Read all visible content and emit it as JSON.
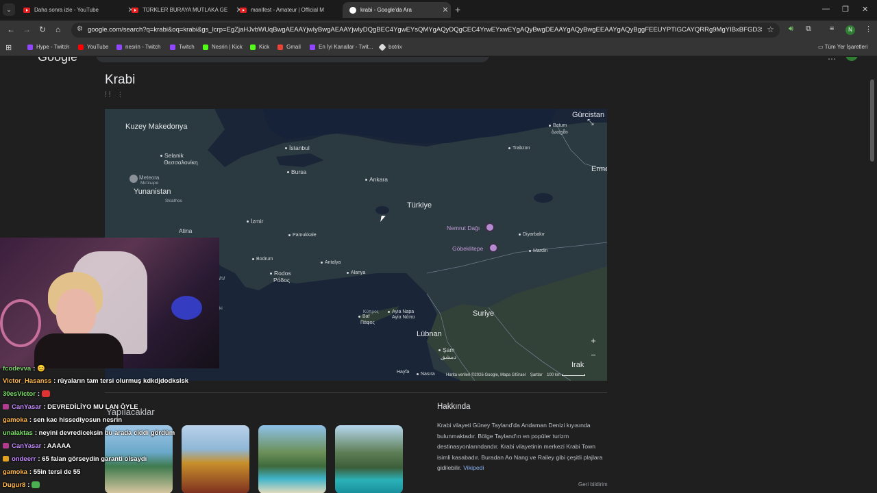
{
  "tabs": [
    {
      "label": "Daha sonra izle - YouTube",
      "icon": "youtube-icon"
    },
    {
      "label": "TÜRKLER BURAYA MUTLAKA GE",
      "icon": "youtube-icon"
    },
    {
      "label": "manifest - Amateur | Official M",
      "icon": "youtube-icon"
    },
    {
      "label": "krabi - Google'da Ara",
      "icon": "google-icon",
      "active": true
    }
  ],
  "address_bar": {
    "url": "google.com/search?q=krabi&oq=krabi&gs_lcrp=EgZjaHJvbWUqBwgAEAAYjwIyBwgAEAAYjwIyDQgBEC4YgwEYsQMYgAQyDQgCEC4YrwEYxwEYgAQyBwgDEAAYgAQyBwgEEAAYgAQyBggFEEUYPTIGCAYQRRg9MgYIBxBFGD3SAQc5NDZqMG..."
  },
  "bookmarks": [
    {
      "label": "Hype - Twitch",
      "color": "#9146ff"
    },
    {
      "label": "YouTube",
      "color": "#ff0000"
    },
    {
      "label": "nesrin - Twitch",
      "color": "#9146ff"
    },
    {
      "label": "Twitch",
      "color": "#9146ff"
    },
    {
      "label": "Nesrin | Kick",
      "color": "#53fc18"
    },
    {
      "label": "Kick",
      "color": "#53fc18"
    },
    {
      "label": "Gmail",
      "color": "#ea4335"
    },
    {
      "label": "En İyi Kanallar - Twit...",
      "color": "#9146ff"
    },
    {
      "label": "botrix",
      "color": "#dddddd"
    }
  ],
  "bookmarks_folder": "Tüm Yer İşaretleri",
  "profile_initial": "N",
  "header": {
    "logo": "Google"
  },
  "entity": {
    "title": "Krabi",
    "subtitle": "⁞⁞ ⋮"
  },
  "map": {
    "countries": [
      "Kuzey Makedonya",
      "Yunanistan",
      "Türkiye",
      "Suriye",
      "Lübnan",
      "Irak",
      "Gürcistan",
      "Erme"
    ],
    "cities": [
      "İstanbul",
      "Bursa",
      "Ankara",
      "İzmir",
      "Pamukkale",
      "Bodrum",
      "Rodos",
      "Ρόδος",
      "Antalya",
      "Alanya",
      "Trabzon",
      "Batum",
      "ბათუმი",
      "Diyarbakır",
      "Mardin",
      "Selanik",
      "Θεσσαλονίκη",
      "Atina",
      "Ayia Napa",
      "Αγία Νάπα",
      "Baf",
      "Πάφος",
      "Şam",
      "دمشق",
      "Hayfa",
      "Nasıra",
      "Meteora",
      "Μετέωρα",
      "Skiathos",
      "Κύπρος",
      "ini",
      "ki"
    ],
    "pois": [
      "Nemrut Dağı",
      "Göbeklitepe"
    ],
    "footer": "Harita verileri ©2026 Google, Mapa GISrael",
    "terms": "Şartlar",
    "scale": "100 km",
    "zoom_in": "+",
    "zoom_out": "−"
  },
  "section": {
    "title": "Yapılacaklar"
  },
  "about": {
    "heading": "Hakkında",
    "text": "Krabi vilayeti Güney Tayland'da Andaman Denizi kıyısında bulunmaktadır. Bölge Tayland'ın en popüler turizm destinasyonlarındandır. Krabi vilayetinin merkezi Krabi Town isimli kasabadır. Buradan Ao Nang ve Railey gibi çeşitli plajlara gidilebilir.",
    "link": "Vikipedi",
    "feedback": "Geri bildirim"
  },
  "chat": [
    {
      "user": "fcodevva",
      "text": "",
      "color": "#7fd36c"
    },
    {
      "user": "Victor_Hasanss",
      "text": "rüyaların tam tersi olurmuş kdkdjdodkslsk",
      "color": "#ffb84d"
    },
    {
      "user": "30esVictor",
      "text": "",
      "color": "#7fe36c"
    },
    {
      "user": "CanYasar",
      "text": "DEVREDİLİYO MU LAN ÖYLE",
      "color": "#c58cff"
    },
    {
      "user": "gamoka",
      "text": "sen kac hissediyosun nesrin",
      "color": "#ffb84d"
    },
    {
      "user": "unalaktas",
      "text": "neyini devrediceksin bu arada ciddi gördüm",
      "color": "#7fe36c"
    },
    {
      "user": "CanYasar",
      "text": "AAAAA",
      "color": "#c58cff"
    },
    {
      "user": "ondeerr",
      "text": "65 falan görseydin garanti olsaydı",
      "color": "#c58cff"
    },
    {
      "user": "gamoka",
      "text": "55in tersi de 55",
      "color": "#ffb84d"
    },
    {
      "user": "Dugur8",
      "text": "",
      "color": "#ffb84d"
    }
  ]
}
